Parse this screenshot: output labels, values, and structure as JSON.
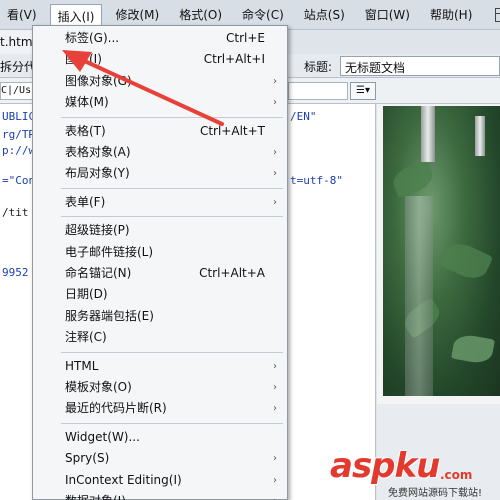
{
  "menubar": {
    "items": [
      "看(V)",
      "插入(I)",
      "修改(M)",
      "格式(O)",
      "命令(C)",
      "站点(S)",
      "窗口(W)",
      "帮助(H)"
    ],
    "active_index": 1
  },
  "document": {
    "tab_label": "t.html*",
    "code_label": "拆分代码",
    "title_label": "标题:",
    "title_value": "无标题文档",
    "address_value": "C|/Us",
    "code_lines": [
      "UBLIC",
      "rg/TR",
      "p://w",
      "=\"Con",
      "/tit",
      "9952",
      "/EN\"",
      "t=utf-8\""
    ]
  },
  "insert_menu": {
    "groups": [
      [
        {
          "label": "标签(G)...",
          "shortcut": "Ctrl+E",
          "submenu": false
        },
        {
          "label": "图像(I)",
          "shortcut": "Ctrl+Alt+I",
          "submenu": false
        },
        {
          "label": "图像对象(G)",
          "shortcut": "",
          "submenu": true
        },
        {
          "label": "媒体(M)",
          "shortcut": "",
          "submenu": true
        }
      ],
      [
        {
          "label": "表格(T)",
          "shortcut": "Ctrl+Alt+T",
          "submenu": false
        },
        {
          "label": "表格对象(A)",
          "shortcut": "",
          "submenu": true
        },
        {
          "label": "布局对象(Y)",
          "shortcut": "",
          "submenu": true
        }
      ],
      [
        {
          "label": "表单(F)",
          "shortcut": "",
          "submenu": true
        }
      ],
      [
        {
          "label": "超级链接(P)",
          "shortcut": "",
          "submenu": false
        },
        {
          "label": "电子邮件链接(L)",
          "shortcut": "",
          "submenu": false
        },
        {
          "label": "命名锚记(N)",
          "shortcut": "Ctrl+Alt+A",
          "submenu": false
        },
        {
          "label": "日期(D)",
          "shortcut": "",
          "submenu": false
        },
        {
          "label": "服务器端包括(E)",
          "shortcut": "",
          "submenu": false
        },
        {
          "label": "注释(C)",
          "shortcut": "",
          "submenu": false
        }
      ],
      [
        {
          "label": "HTML",
          "shortcut": "",
          "submenu": true
        },
        {
          "label": "模板对象(O)",
          "shortcut": "",
          "submenu": true
        },
        {
          "label": "最近的代码片断(R)",
          "shortcut": "",
          "submenu": true
        }
      ],
      [
        {
          "label": "Widget(W)...",
          "shortcut": "",
          "submenu": false
        },
        {
          "label": "Spry(S)",
          "shortcut": "",
          "submenu": true
        },
        {
          "label": "InContext Editing(I)",
          "shortcut": "",
          "submenu": true
        },
        {
          "label": "数据对象(J)",
          "shortcut": "",
          "submenu": true
        }
      ]
    ]
  },
  "watermark": {
    "brand": "aspku",
    "domain": ".com",
    "slogan": "免费网站源码下载站!"
  },
  "colors": {
    "annotation_arrow": "#e8413a",
    "code_text": "#1a3fb0",
    "watermark": "#e23a2e"
  }
}
